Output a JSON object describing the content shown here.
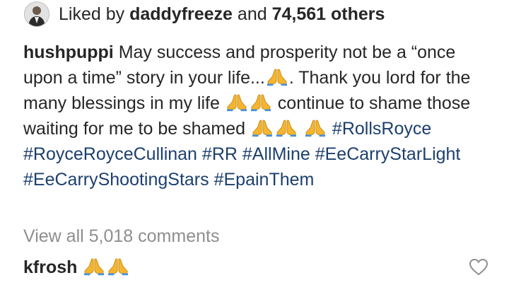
{
  "likes": {
    "prefix": "Liked by",
    "user": "daddyfreeze",
    "joiner": "and",
    "count": "74,561 others"
  },
  "post": {
    "username": "hushpuppi",
    "caption_part1": "May success and prosperity not be a “once upon a time” story in your life...",
    "caption_part2": ". Thank you lord for the many blessings in my life",
    "caption_part3": "continue to shame those waiting for me to be shamed",
    "hashtags": [
      "#RollsRoyce",
      "#RoyceRoyceCullinan",
      "#RR",
      "#AllMine",
      "#EeCarryStarLight",
      "#EeCarryShootingStars",
      "#EpainThem"
    ]
  },
  "comments_link": "View all 5,018 comments",
  "comment": {
    "username": "kfrosh"
  },
  "icons": {
    "pray": "folded-hands-emoji",
    "like": "heart-outline-icon"
  },
  "colors": {
    "text": "#262626",
    "hashtag": "#1c3f6e",
    "muted": "#8e8e8e",
    "emoji": "#f5b52e"
  }
}
